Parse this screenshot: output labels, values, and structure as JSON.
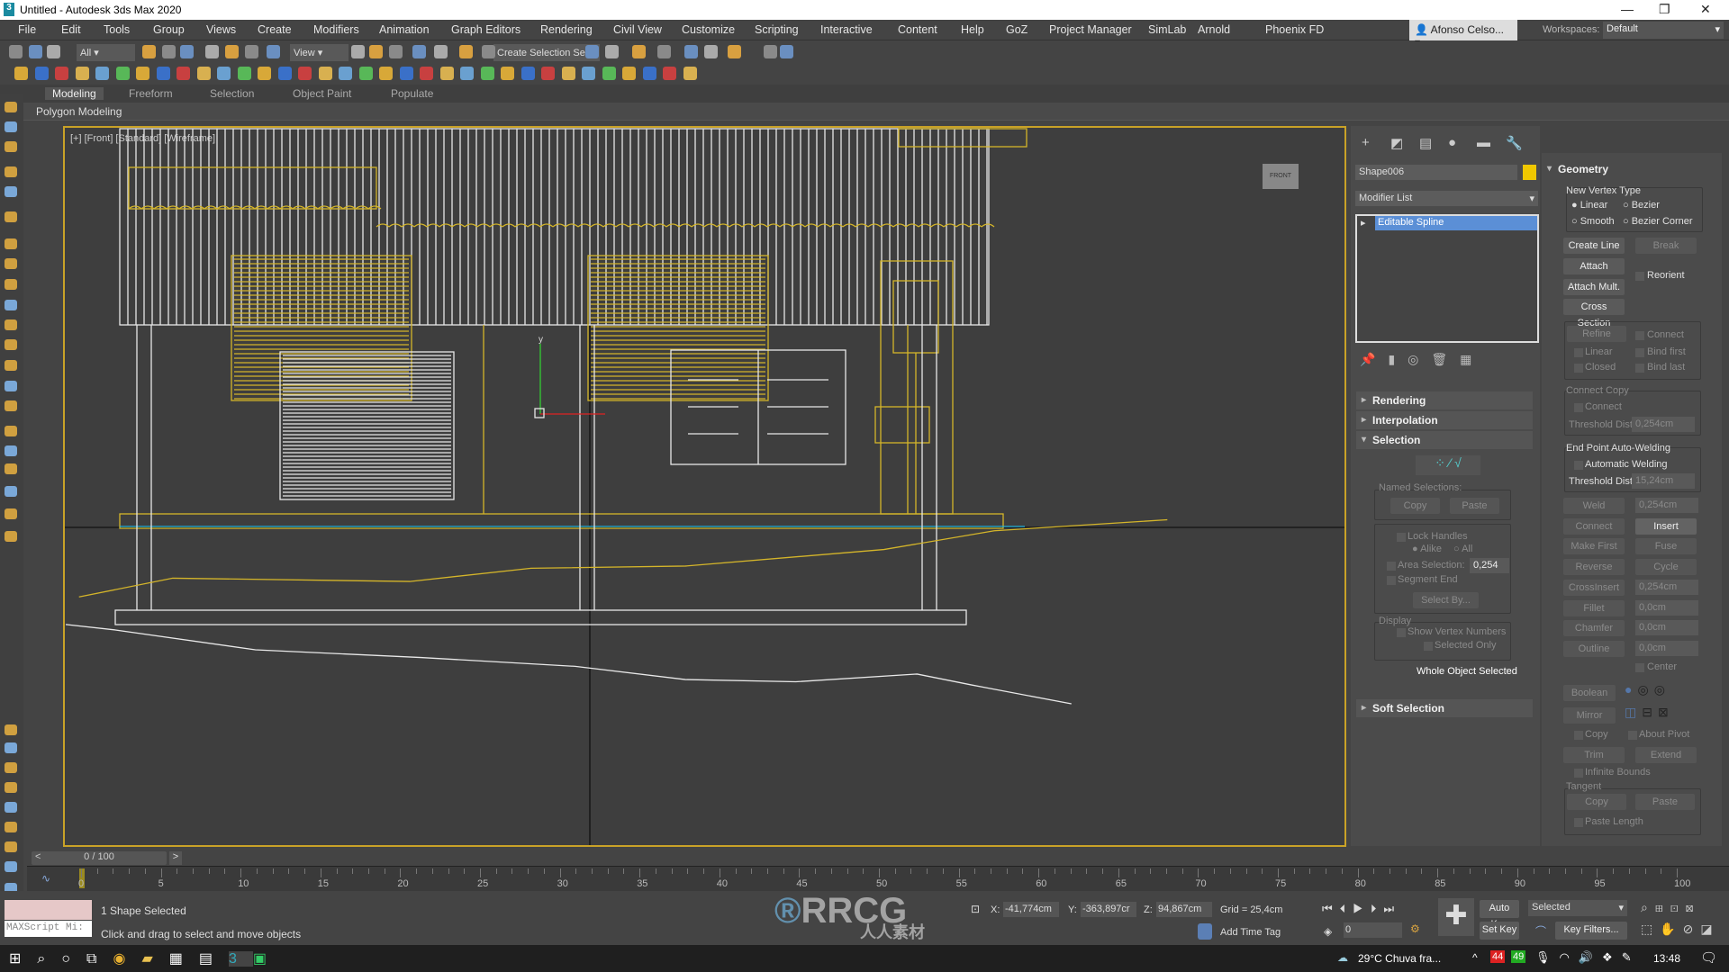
{
  "window": {
    "title": "Untitled - Autodesk 3ds Max 2020",
    "app_icon": "3"
  },
  "menu": [
    "File",
    "Edit",
    "Tools",
    "Group",
    "Views",
    "Create",
    "Modifiers",
    "Animation",
    "Graph Editors",
    "Rendering",
    "Civil View",
    "Customize",
    "Scripting",
    "Interactive",
    "Content",
    "Help",
    "GoZ",
    "Project Manager",
    "SimLab",
    "Arnold",
    "Phoenix FD"
  ],
  "user": "Afonso Celso...",
  "workspaces": {
    "label": "Workspaces:",
    "value": "Default"
  },
  "toolbar": {
    "filter": "All",
    "ref_coord": "View",
    "selection_set": "Create Selection Se"
  },
  "ribbon": {
    "tabs": [
      "Modeling",
      "Freeform",
      "Selection",
      "Object Paint",
      "Populate"
    ],
    "active": "Modeling",
    "panel": "Polygon Modeling"
  },
  "viewport": {
    "label": "[+] [Front] [Standard] [Wireframe]",
    "viewcube": "FRONT",
    "colors": {
      "selected": "#d4b52a",
      "wire": "#e8e8e8",
      "border": "#c9a227"
    }
  },
  "command_panel": {
    "object_name": "Shape006",
    "object_color": "#f0c800",
    "modifier_list": "Modifier List",
    "stack": [
      "Editable Spline"
    ],
    "rollouts": {
      "rendering": "Rendering",
      "interpolation": "Interpolation",
      "selection": "Selection",
      "soft_selection": "Soft Selection"
    },
    "selection": {
      "named": "Named Selections:",
      "copy": "Copy",
      "paste": "Paste",
      "lock_handles": "Lock Handles",
      "alike": "Alike",
      "all": "All",
      "area_selection": "Area Selection:",
      "area_value": "0,254",
      "segment_end": "Segment End",
      "select_by": "Select By...",
      "display": "Display",
      "show_vertex_numbers": "Show Vertex Numbers",
      "selected_only": "Selected Only",
      "status": "Whole Object Selected"
    }
  },
  "geometry": {
    "title": "Geometry",
    "new_vertex_type": "New Vertex Type",
    "linear": "Linear",
    "bezier": "Bezier",
    "smooth": "Smooth",
    "bezier_corner": "Bezier Corner",
    "create_line": "Create Line",
    "break": "Break",
    "attach": "Attach",
    "reorient": "Reorient",
    "attach_mult": "Attach Mult.",
    "cross_section": "Cross Section",
    "refine": "Refine",
    "connect": "Connect",
    "linear_chk": "Linear",
    "bind_first": "Bind first",
    "closed": "Closed",
    "bind_last": "Bind last",
    "connect_copy": "Connect Copy",
    "connect2": "Connect",
    "threshold_dist": "Threshold Dist",
    "threshold_value": "0,254cm",
    "end_point": "End Point Auto-Welding",
    "auto_weld": "Automatic Welding",
    "threshold_dist2": "Threshold Dist",
    "threshold_value2": "15,24cm",
    "weld": "Weld",
    "weld_value": "0,254cm",
    "connect3": "Connect",
    "insert": "Insert",
    "make_first": "Make First",
    "fuse": "Fuse",
    "reverse": "Reverse",
    "cycle": "Cycle",
    "crossinsert": "CrossInsert",
    "crossinsert_value": "0,254cm",
    "fillet": "Fillet",
    "fillet_value": "0,0cm",
    "chamfer": "Chamfer",
    "chamfer_value": "0,0cm",
    "outline": "Outline",
    "outline_value": "0,0cm",
    "center": "Center",
    "boolean": "Boolean",
    "mirror": "Mirror",
    "copy": "Copy",
    "about_pivot": "About Pivot",
    "trim": "Trim",
    "extend": "Extend",
    "infinite_bounds": "Infinite Bounds",
    "tangent": "Tangent",
    "t_copy": "Copy",
    "t_paste": "Paste",
    "paste_length": "Paste Length"
  },
  "timeline": {
    "frame": "0 / 100",
    "ticks": [
      "0",
      "5",
      "10",
      "15",
      "20",
      "25",
      "30",
      "35",
      "40",
      "45",
      "50",
      "55",
      "60",
      "65",
      "70",
      "75",
      "80",
      "85",
      "90",
      "95",
      "100"
    ]
  },
  "status": {
    "selection": "1 Shape Selected",
    "prompt": "Click and drag to select and move objects",
    "maxscript": "MAXScript Mi:",
    "x_label": "X:",
    "x": "-41,774cm",
    "y_label": "Y:",
    "y": "-363,897cr",
    "z_label": "Z:",
    "z": "94,867cm",
    "grid": "Grid = 25,4cm",
    "add_time_tag": "Add Time Tag",
    "frame_value": "0",
    "auto_key": "Auto Key",
    "set_key": "Set Key",
    "key_mode": "Selected",
    "key_filters": "Key Filters..."
  },
  "watermark": {
    "text": "RRCG",
    "sub": "人人素材"
  },
  "taskbar": {
    "weather": "29°C  Chuva fra...",
    "badge1": "44",
    "badge2": "49",
    "time": "13:48"
  }
}
